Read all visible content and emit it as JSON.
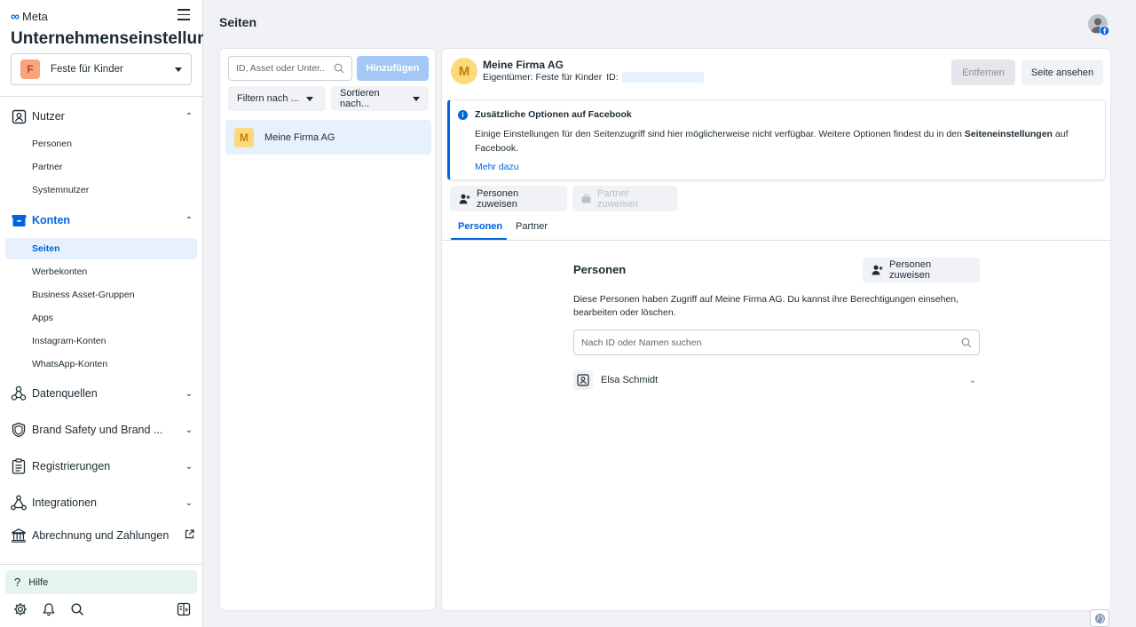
{
  "sidebar": {
    "brand": "Meta",
    "title": "Unternehmenseinstellungen",
    "business": {
      "initial": "F",
      "name": "Feste für Kinder"
    },
    "sections": {
      "nutzer": {
        "label": "Nutzer",
        "items": [
          "Personen",
          "Partner",
          "Systemnutzer"
        ]
      },
      "konten": {
        "label": "Konten",
        "items": [
          "Seiten",
          "Werbekonten",
          "Business Asset-Gruppen",
          "Apps",
          "Instagram-Konten",
          "WhatsApp-Konten"
        ]
      },
      "datenquellen": {
        "label": "Datenquellen"
      },
      "brand_safety": {
        "label": "Brand Safety und Brand ..."
      },
      "registrierungen": {
        "label": "Registrierungen"
      },
      "integrationen": {
        "label": "Integrationen"
      },
      "abrechnung": {
        "label": "Abrechnung und Zahlungen"
      }
    },
    "help_label": "Hilfe"
  },
  "header": {
    "title": "Seiten"
  },
  "list_panel": {
    "search_placeholder": "ID, Asset oder Unter...",
    "add_label": "Hinzufügen",
    "filter_label": "Filtern nach ...",
    "sort_label": "Sortieren nach...",
    "items": [
      {
        "initial": "M",
        "name": "Meine Firma AG"
      }
    ]
  },
  "detail": {
    "initial": "M",
    "name": "Meine Firma AG",
    "owner_label": "Eigentümer: Feste für Kinder",
    "id_label": "ID:",
    "remove_label": "Entfernen",
    "view_label": "Seite ansehen",
    "notice": {
      "title": "Zusätzliche Optionen auf Facebook",
      "text_before": "Einige Einstellungen für den Seitenzugriff sind hier möglicherweise nicht verfügbar. Weitere Optionen findest du in den ",
      "text_bold": "Seiteneinstellungen",
      "text_after": " auf Facebook.",
      "link": "Mehr dazu"
    },
    "assign_people_label": "Personen zuweisen",
    "assign_partner_label": "Partner zuweisen",
    "tabs": [
      "Personen",
      "Partner"
    ],
    "people_section": {
      "title": "Personen",
      "assign_label": "Personen zuweisen",
      "description": "Diese Personen haben Zugriff auf Meine Firma AG. Du kannst ihre Berechtigungen einsehen, bearbeiten oder löschen.",
      "search_placeholder": "Nach ID oder Namen suchen",
      "people": [
        {
          "name": "Elsa Schmidt"
        }
      ]
    }
  },
  "colors": {
    "accent": "#0064e0",
    "selected_bg": "#e7f0fd",
    "help_bg": "#e6f4ee"
  }
}
